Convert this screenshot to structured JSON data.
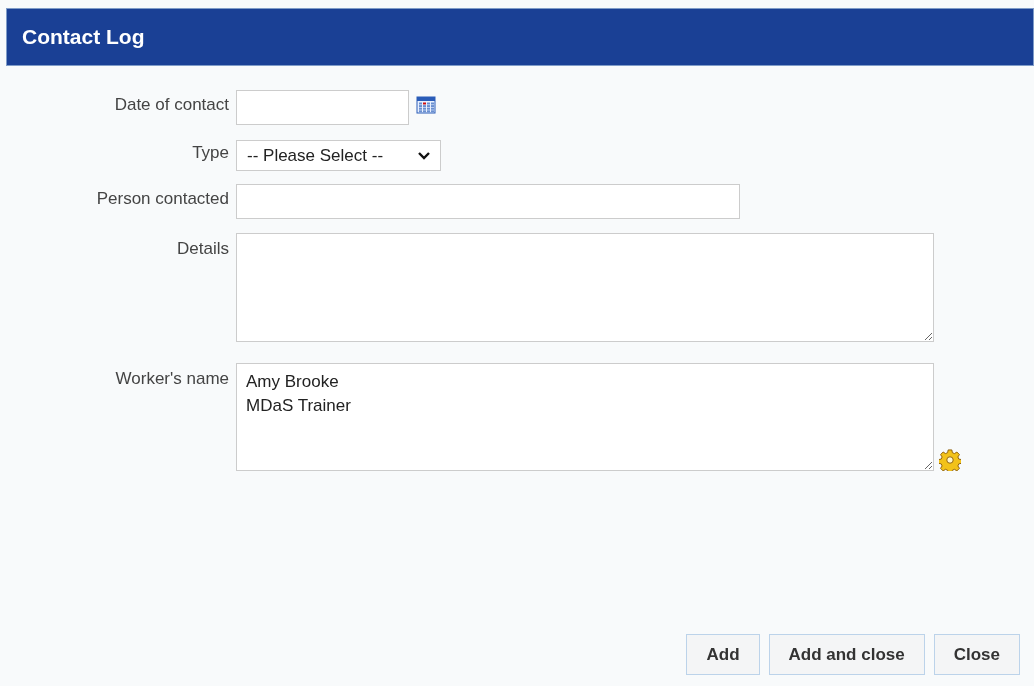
{
  "window": {
    "title": "Contact Log"
  },
  "form": {
    "date_of_contact": {
      "label": "Date of contact"
    },
    "type": {
      "label": "Type",
      "value": "-- Please Select --"
    },
    "person_contacted": {
      "label": "Person contacted"
    },
    "details": {
      "label": "Details"
    },
    "workers_name": {
      "label": "Worker's name",
      "value": "Amy Brooke\nMDaS Trainer"
    }
  },
  "buttons": [
    {
      "label": "Add"
    },
    {
      "label": "Add and close"
    },
    {
      "label": "Close"
    }
  ]
}
